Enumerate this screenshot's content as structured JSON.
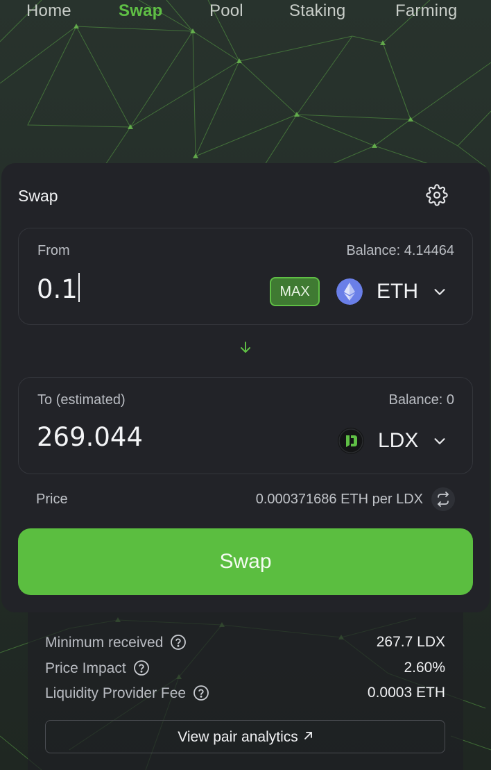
{
  "nav": {
    "items": [
      "Home",
      "Swap",
      "Pool",
      "Staking",
      "Farming"
    ],
    "active": "Swap"
  },
  "swap": {
    "title": "Swap",
    "from": {
      "label": "From",
      "balance": "Balance: 4.14464",
      "amount": "0.1",
      "max_label": "MAX",
      "token": "ETH",
      "token_icon": "ethereum-icon"
    },
    "to": {
      "label": "To (estimated)",
      "balance": "Balance: 0",
      "amount": "269.044",
      "token": "LDX",
      "token_icon": "ldx-icon"
    },
    "price_label": "Price",
    "price_value": "0.000371686 ETH per LDX",
    "swap_button": "Swap"
  },
  "details": {
    "minimum_received_label": "Minimum received",
    "minimum_received_value": "267.7 LDX",
    "price_impact_label": "Price Impact",
    "price_impact_value": "2.60%",
    "lp_fee_label": "Liquidity Provider Fee",
    "lp_fee_value": "0.0003 ETH",
    "analytics_link": "View pair analytics"
  },
  "colors": {
    "accent": "#5bbe40",
    "card": "#222328",
    "background": "#24302a"
  }
}
